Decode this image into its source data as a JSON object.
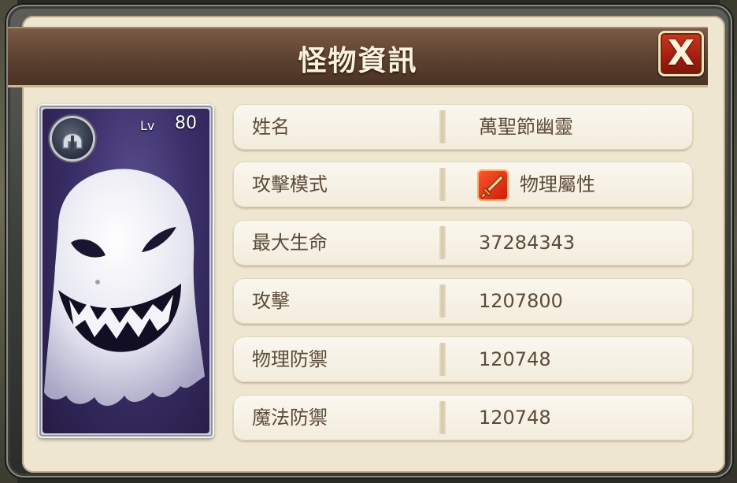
{
  "dialog": {
    "title": "怪物資訊",
    "close_label": "X"
  },
  "monster_card": {
    "level_label": "Lv",
    "level_value": "80",
    "class_icon": "helmet-icon",
    "portrait": "ghost-portrait"
  },
  "info_rows": [
    {
      "label": "姓名",
      "value": "萬聖節幽靈"
    },
    {
      "label": "攻擊模式",
      "value": "物理屬性",
      "icon": "sword-icon"
    },
    {
      "label": "最大生命",
      "value": "37284343"
    },
    {
      "label": "攻擊",
      "value": "1207800"
    },
    {
      "label": "物理防禦",
      "value": "120748"
    },
    {
      "label": "魔法防禦",
      "value": "120748"
    }
  ],
  "colors": {
    "title_bar": "#5b412f",
    "panel_bg": "#efe6d1",
    "row_text": "#5b4a3a",
    "close_button": "#a01e10",
    "attack_icon": "#e03010"
  }
}
